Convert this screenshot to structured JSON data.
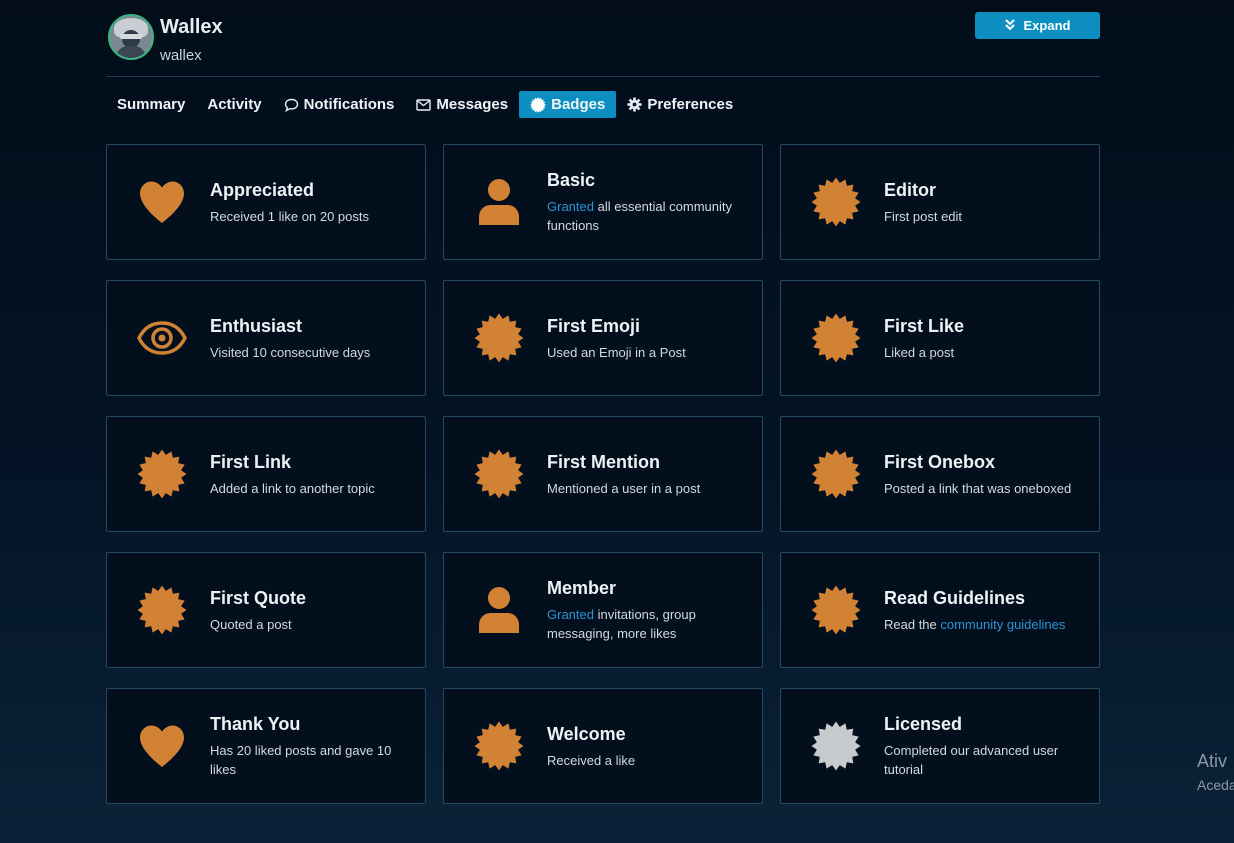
{
  "user": {
    "display_name": "Wallex",
    "username": "wallex"
  },
  "header": {
    "expand_label": "Expand"
  },
  "nav": {
    "summary": "Summary",
    "activity": "Activity",
    "notifications": "Notifications",
    "messages": "Messages",
    "badges": "Badges",
    "preferences": "Preferences"
  },
  "colors": {
    "accent": "#0c8fc0",
    "badge_bronze": "#d28234",
    "badge_silver": "#c8cbce",
    "link": "#2c93d6"
  },
  "badges": [
    {
      "icon": "heart-icon",
      "title": "Appreciated",
      "desc": "Received 1 like on 20 posts"
    },
    {
      "icon": "user-icon",
      "title": "Basic",
      "desc_link": "Granted",
      "desc": " all essential community functions"
    },
    {
      "icon": "certificate-icon",
      "title": "Editor",
      "desc": "First post edit"
    },
    {
      "icon": "eye-icon",
      "title": "Enthusiast",
      "desc": "Visited 10 consecutive days"
    },
    {
      "icon": "certificate-icon",
      "title": "First Emoji",
      "desc": "Used an Emoji in a Post"
    },
    {
      "icon": "certificate-icon",
      "title": "First Like",
      "desc": "Liked a post"
    },
    {
      "icon": "certificate-icon",
      "title": "First Link",
      "desc": "Added a link to another topic"
    },
    {
      "icon": "certificate-icon",
      "title": "First Mention",
      "desc": "Mentioned a user in a post"
    },
    {
      "icon": "certificate-icon",
      "title": "First Onebox",
      "desc": "Posted a link that was oneboxed"
    },
    {
      "icon": "certificate-icon",
      "title": "First Quote",
      "desc": "Quoted a post"
    },
    {
      "icon": "user-icon",
      "title": "Member",
      "desc_link": "Granted",
      "desc": " invitations, group messaging, more likes"
    },
    {
      "icon": "certificate-icon",
      "title": "Read Guidelines",
      "desc_prefix": "Read the ",
      "desc_link": "community guidelines"
    },
    {
      "icon": "heart-icon",
      "title": "Thank You",
      "desc": "Has 20 liked posts and gave 10 likes"
    },
    {
      "icon": "certificate-icon",
      "title": "Welcome",
      "desc": "Received a like"
    },
    {
      "icon": "certificate-icon",
      "title": "Licensed",
      "desc": "Completed our advanced user tutorial",
      "silver": true
    }
  ],
  "watermark": {
    "line1": "Ativ",
    "line2": "Aceda"
  }
}
